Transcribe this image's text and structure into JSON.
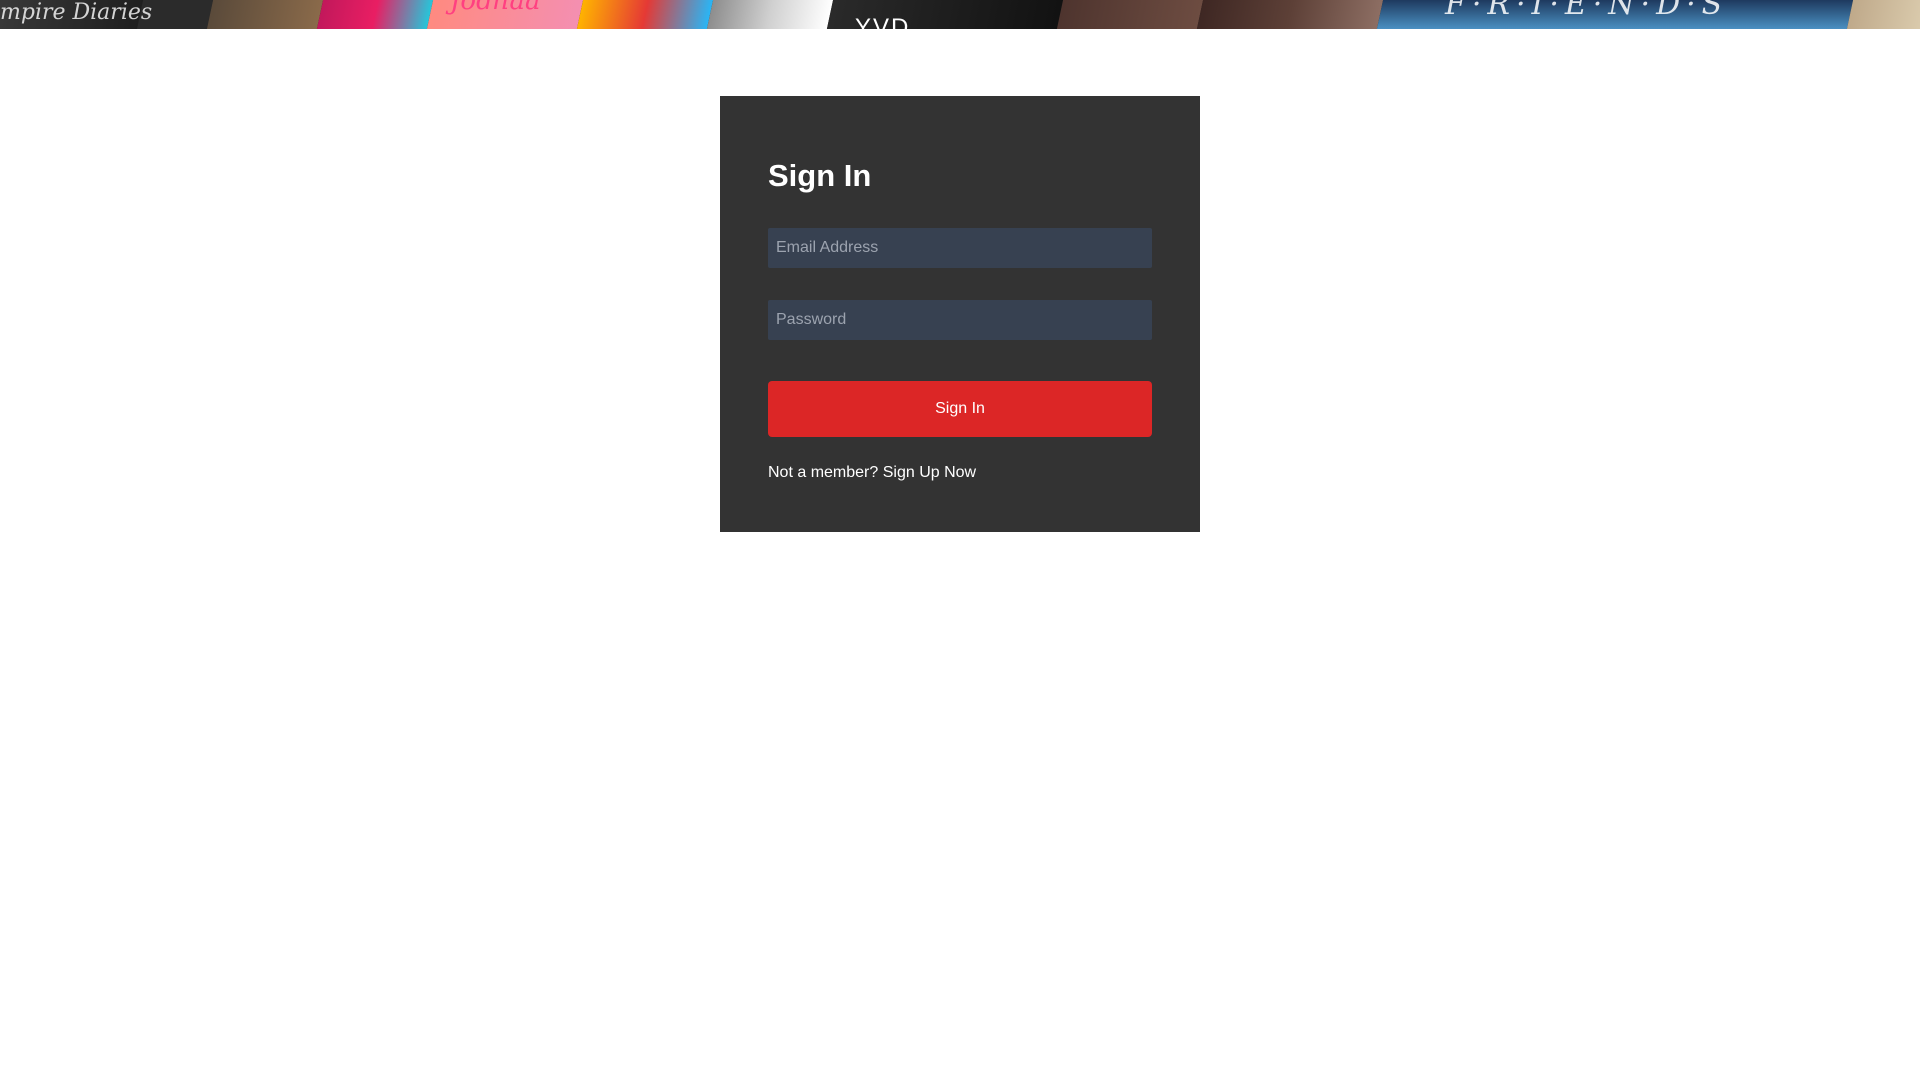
{
  "banner": {
    "titles": [
      "mpire Diaries",
      "Jodhaa",
      "F·R·I·E·N·D·S"
    ],
    "center_title": "YVD"
  },
  "form": {
    "title": "Sign In",
    "email_placeholder": "Email Address",
    "password_placeholder": "Password",
    "submit_label": "Sign In",
    "signup_prompt": "Not a member?",
    "signup_link": "Sign Up Now"
  },
  "colors": {
    "card_bg": "#333333",
    "input_bg": "#374151",
    "button_bg": "#dc2626"
  }
}
